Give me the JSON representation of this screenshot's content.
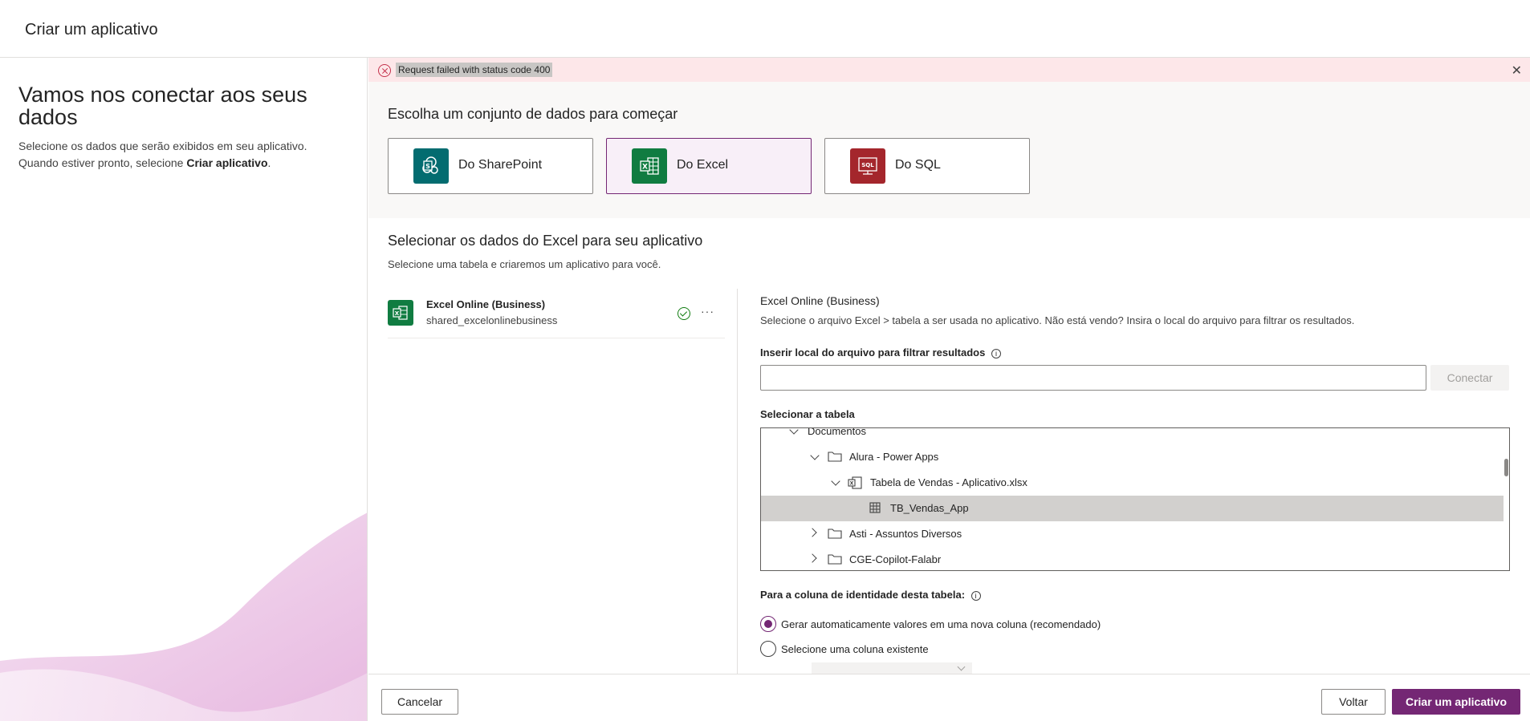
{
  "header": {
    "title": "Criar um aplicativo"
  },
  "left": {
    "heading": "Vamos nos conectar aos seus dados",
    "description_prefix": "Selecione os dados que serão exibidos em seu aplicativo. Quando estiver pronto, selecione ",
    "description_bold": "Criar aplicativo",
    "description_suffix": "."
  },
  "error": {
    "message": "Request failed with status code 400",
    "close_glyph": "✕"
  },
  "datasource": {
    "heading": "Escolha um conjunto de dados para começar",
    "options": [
      {
        "label": "Do SharePoint",
        "color": "#036c70",
        "icon": "sharepoint-icon",
        "selected": false
      },
      {
        "label": "Do Excel",
        "color": "#107c41",
        "icon": "excel-icon",
        "selected": true
      },
      {
        "label": "Do SQL",
        "color": "#a4262c",
        "icon": "sql-icon",
        "selected": false
      }
    ]
  },
  "excel_section": {
    "title": "Selecionar os dados do Excel para seu aplicativo",
    "subtitle": "Selecione uma tabela e criaremos um aplicativo para você."
  },
  "connection": {
    "name": "Excel Online (Business)",
    "id": "shared_excelonlinebusiness",
    "status_icon": "check-circle-icon",
    "more": "···"
  },
  "right_panel": {
    "title": "Excel Online (Business)",
    "description": "Selecione o arquivo Excel > tabela a ser usada no aplicativo. Não está vendo? Insira o local do arquivo para filtrar os resultados.",
    "path_label": "Inserir local do arquivo para filtrar resultados",
    "path_value": "",
    "connect_button": "Conectar",
    "table_label": "Selecionar a tabela",
    "tree": [
      {
        "label": "Documentos",
        "type": "none",
        "expanded": true,
        "selected": false
      },
      {
        "label": "Alura - Power Apps",
        "type": "folder",
        "expanded": true,
        "selected": false
      },
      {
        "label": "Tabela de Vendas - Aplicativo.xlsx",
        "type": "excel-file",
        "expanded": true,
        "selected": false
      },
      {
        "label": "TB_Vendas_App",
        "type": "table",
        "expanded": null,
        "selected": true
      },
      {
        "label": "Asti - Assuntos Diversos",
        "type": "folder",
        "expanded": false,
        "selected": false
      },
      {
        "label": "CGE-Copilot-Falabr",
        "type": "folder",
        "expanded": false,
        "selected": false
      }
    ],
    "identity_label": "Para a coluna de identidade desta tabela:",
    "identity_options": [
      {
        "label": "Gerar automaticamente valores em uma nova coluna (recomendado)",
        "checked": true
      },
      {
        "label": "Selecione uma coluna existente",
        "checked": false
      }
    ],
    "info_glyph": "i"
  },
  "footer": {
    "cancel": "Cancelar",
    "back": "Voltar",
    "create": "Criar um aplicativo"
  },
  "colors": {
    "accent": "#742774",
    "error_bg": "#fde7e9",
    "selected_row": "#d2d0ce"
  }
}
